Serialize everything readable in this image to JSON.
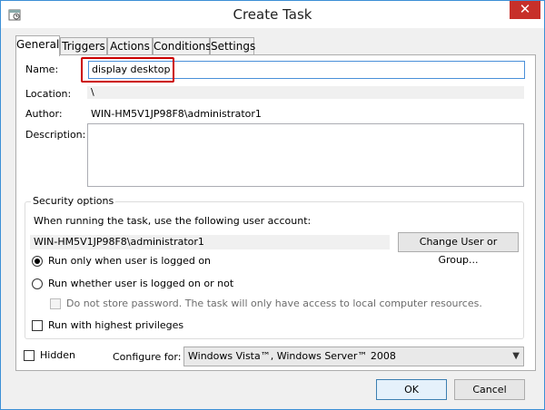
{
  "window": {
    "title": "Create Task",
    "close_glyph": "✕",
    "icon": "task-scheduler-icon"
  },
  "tabs": [
    {
      "label": "General"
    },
    {
      "label": "Triggers"
    },
    {
      "label": "Actions"
    },
    {
      "label": "Conditions"
    },
    {
      "label": "Settings"
    }
  ],
  "general": {
    "name_label": "Name:",
    "name_value": "display desktop",
    "location_label": "Location:",
    "location_value": "\\",
    "author_label": "Author:",
    "author_value": "WIN-HM5V1JP98F8\\administrator1",
    "description_label": "Description:",
    "description_value": ""
  },
  "security": {
    "title": "Security options",
    "account_prompt": "When running the task, use the following user account:",
    "account_value": "WIN-HM5V1JP98F8\\administrator1",
    "change_button": "Change User or Group...",
    "radio_logged_on": "Run only when user is logged on",
    "radio_whether": "Run whether user is logged on or not",
    "no_store_password": "Do not store password.  The task will only have access to local computer resources.",
    "highest_privileges": "Run with highest privileges"
  },
  "bottom": {
    "hidden_label": "Hidden",
    "configure_label": "Configure for:",
    "configure_value": "Windows Vista™, Windows Server™ 2008"
  },
  "footer": {
    "ok": "OK",
    "cancel": "Cancel"
  }
}
